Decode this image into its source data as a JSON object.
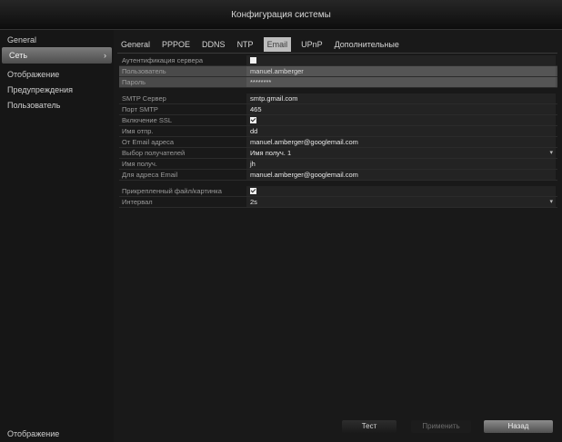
{
  "window": {
    "title": "Конфигурация системы"
  },
  "sidebar": {
    "items": [
      {
        "label": "General"
      },
      {
        "label": "Сеть"
      },
      {
        "label": "Отображение"
      },
      {
        "label": "Предупреждения"
      },
      {
        "label": "Пользователь"
      }
    ],
    "active_index": 1,
    "bottom_label": "Отображение"
  },
  "tabs": [
    {
      "label": "General"
    },
    {
      "label": "PPPOE"
    },
    {
      "label": "DDNS"
    },
    {
      "label": "NTP"
    },
    {
      "label": "Email"
    },
    {
      "label": "UPnP"
    },
    {
      "label": "Дополнительные"
    }
  ],
  "active_tab_index": 4,
  "form": {
    "rows": [
      {
        "label": "Аутентификация сервера",
        "type": "checkbox",
        "checked": false,
        "disabled": false
      },
      {
        "label": "Пользователь",
        "value": "manuel.amberger",
        "disabled": true
      },
      {
        "label": "Пароль",
        "value": "********",
        "disabled": true
      },
      {
        "label": "SMTP Сервер",
        "value": "smtp.gmail.com",
        "disabled": false
      },
      {
        "label": "Порт SMTP",
        "value": "465",
        "disabled": false
      },
      {
        "label": "Включение SSL",
        "type": "checkbox",
        "checked": true,
        "disabled": false
      },
      {
        "label": "Имя отпр.",
        "value": "dd",
        "disabled": false
      },
      {
        "label": "От Email адреса",
        "value": "manuel.amberger@googlemail.com",
        "disabled": false
      },
      {
        "label": "Выбор получателей",
        "value": "Имя получ. 1",
        "type": "dropdown",
        "disabled": false
      },
      {
        "label": "Имя получ.",
        "value": "jh",
        "disabled": false
      },
      {
        "label": "Для адреса Email",
        "value": "manuel.amberger@googlemail.com",
        "disabled": false
      },
      {
        "label": "Прикрепленный файл/картинка",
        "type": "checkbox",
        "checked": true,
        "disabled": false
      },
      {
        "label": "Интервал",
        "value": "2s",
        "type": "dropdown",
        "disabled": false
      }
    ]
  },
  "buttons": {
    "test": "Тест",
    "apply": "Применить",
    "back": "Назад"
  },
  "colors": {
    "background": "#141414",
    "panel": "#191919",
    "active_item": "#6a6a6a",
    "text": "#d8d8d8"
  }
}
